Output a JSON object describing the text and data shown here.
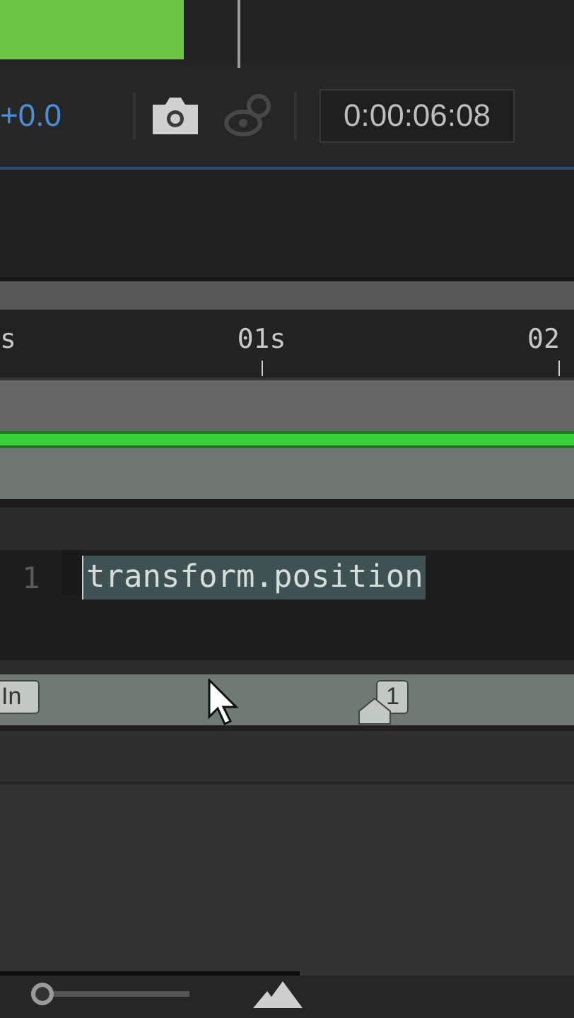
{
  "viewer": {
    "exposure": "+0.0",
    "timecode": "0:00:06:08"
  },
  "ruler": {
    "labels": [
      "s",
      "01s",
      "02"
    ]
  },
  "expression": {
    "line_number": "1",
    "code": "transform.position",
    "selected": true
  },
  "markers": [
    {
      "kind": "in",
      "label": "In"
    },
    {
      "kind": "comp",
      "label": "1"
    }
  ],
  "zoom_slider": {
    "level": 0.0
  }
}
